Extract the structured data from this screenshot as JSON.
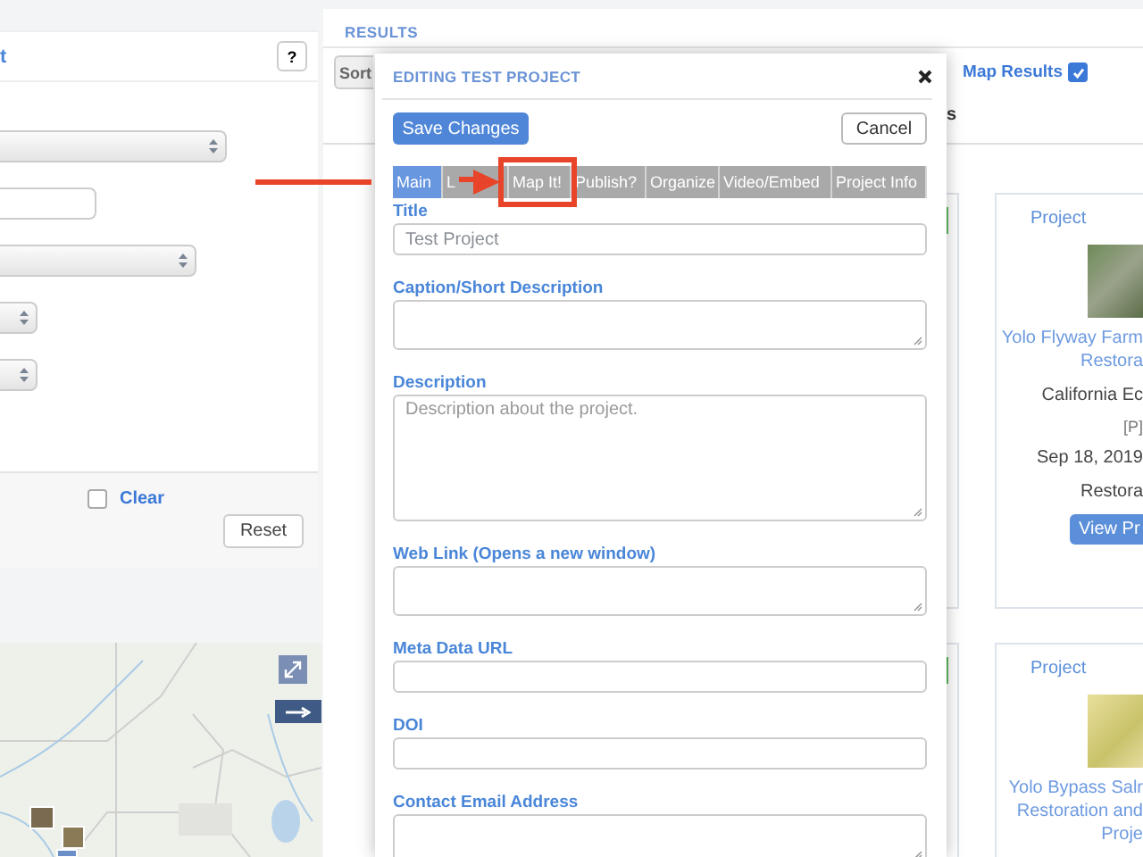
{
  "filter_panel": {
    "title": "t",
    "help_button": "?",
    "fields": [
      {
        "kind": "select"
      },
      {
        "kind": "input"
      },
      {
        "kind": "select"
      },
      {
        "kind": "select"
      },
      {
        "kind": "select"
      }
    ],
    "clear_checkbox": {
      "label": "Clear",
      "checked": false
    },
    "reset_button": "Reset"
  },
  "results": {
    "title": "RESULTS",
    "sort_button": "Sort",
    "map_results": {
      "label": "Map Results",
      "checked": true
    },
    "heading_fragment": "s",
    "cards": [
      {
        "type_label": "Project",
        "title_lines": [
          "Yolo Flyway Farm",
          "Restora"
        ],
        "org": "California Ec",
        "tag": "[P]",
        "date": "Sep 18, 2019",
        "category": "Restora",
        "button": "View Pr"
      },
      {
        "type_label": "Project",
        "title_lines": [
          "Yolo Bypass Salr",
          "Restoration and",
          "Proje"
        ]
      }
    ]
  },
  "modal": {
    "title": "EDITING TEST PROJECT",
    "save_button": "Save Changes",
    "cancel_button": "Cancel",
    "tabs": [
      {
        "label": "Main",
        "selected": true,
        "highlighted": false
      },
      {
        "label": "L",
        "selected": false,
        "highlighted": false
      },
      {
        "label": "Map It!",
        "selected": false,
        "highlighted": true
      },
      {
        "label": "Publish?",
        "selected": false,
        "highlighted": false
      },
      {
        "label": "Organize",
        "selected": false,
        "highlighted": false
      },
      {
        "label": "Video/Embed",
        "selected": false,
        "highlighted": false
      },
      {
        "label": "Project Info",
        "selected": false,
        "highlighted": false
      }
    ],
    "fields": [
      {
        "label": "Title",
        "kind": "input",
        "value": "Test Project"
      },
      {
        "label": "Caption/Short Description",
        "kind": "textarea"
      },
      {
        "label": "Description",
        "kind": "large_textarea",
        "placeholder": "Description about the project."
      },
      {
        "label": "Web Link (Opens a new window)",
        "kind": "textarea"
      },
      {
        "label": "Meta Data URL",
        "kind": "input"
      },
      {
        "label": "DOI",
        "kind": "input"
      },
      {
        "label": "Contact Email Address",
        "kind": "textarea"
      }
    ]
  }
}
